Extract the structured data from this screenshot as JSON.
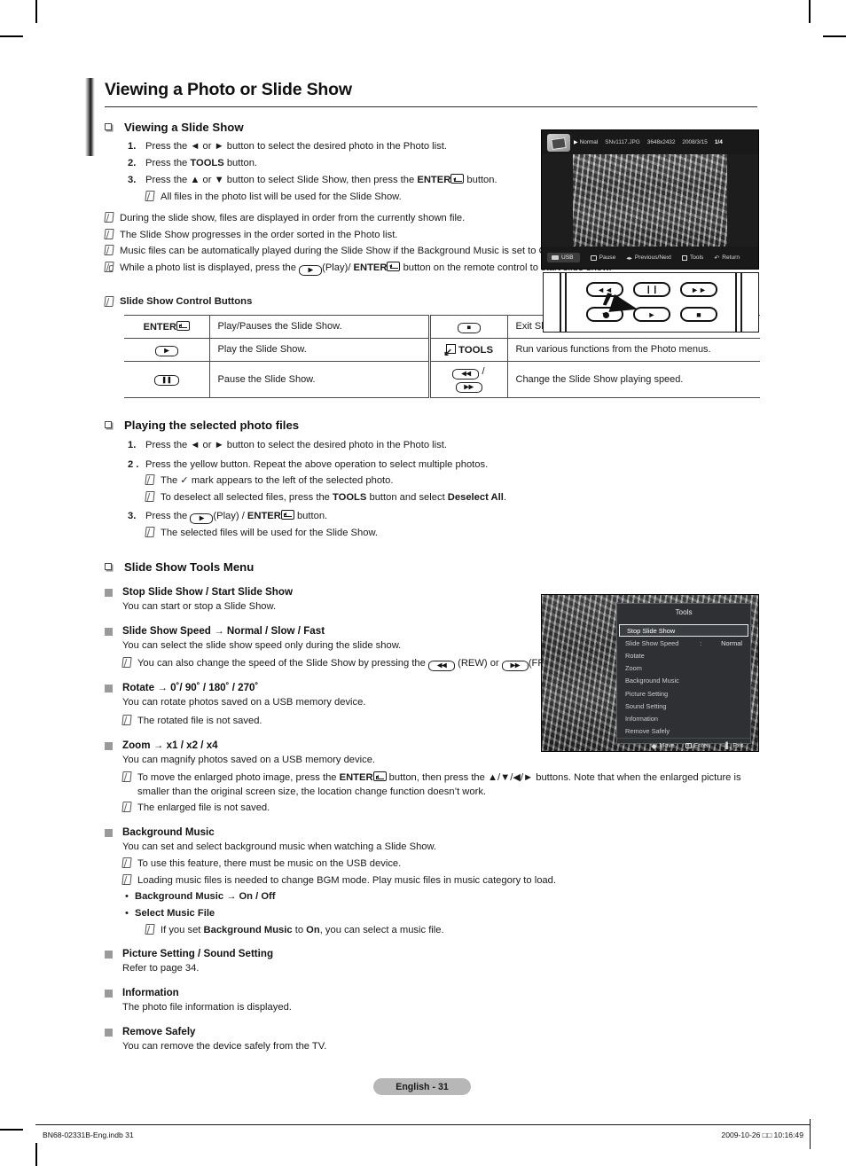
{
  "page": {
    "title": "Viewing a Photo or Slide Show",
    "page_badge": "English - 31",
    "footer_left": "BN68-02331B-Eng.indb  31",
    "footer_right": "2009-10-26  □□ 10:16:49"
  },
  "section_slideshow": {
    "heading": "Viewing a Slide Show",
    "steps": [
      {
        "num": "1.",
        "text": "Press the ◄ or ► button to select the desired photo in the Photo list."
      },
      {
        "num": "2.",
        "text_pre": "Press the ",
        "bold": "TOOLS",
        "text_post": " button."
      },
      {
        "num": "3.",
        "text_pre": "Press the ▲ or ▼ button to select Slide Show, then press the ",
        "bold": "ENTER",
        "text_post": " button."
      }
    ],
    "step3_note": "All files in the photo list will be used for the Slide Show.",
    "notes": [
      "During the slide show, files are displayed in order from the currently shown file.",
      "The Slide Show progresses in the order sorted in the Photo list.",
      "Music files can be automatically played during the Slide Show if the Background Music is set to On."
    ],
    "hand_note_pre": "While a photo list is displayed, press the ",
    "hand_note_mid": "(Play)/ ",
    "hand_note_bold": "ENTER",
    "hand_note_post": " button on the remote control to start slide show."
  },
  "control_table": {
    "title": "Slide Show Control Buttons",
    "rows": [
      {
        "key_left": "ENTER",
        "key_left_type": "enter",
        "desc_left": "Play/Pauses the Slide Show.",
        "key_right": "■",
        "key_right_type": "capsule",
        "desc_right": "Exit Slide Show and return to the photo list."
      },
      {
        "key_left": "►",
        "key_left_type": "capsule",
        "desc_left": "Play the Slide Show.",
        "key_right": "TOOLS",
        "key_right_type": "tools",
        "desc_right": "Run various functions from the Photo menus."
      },
      {
        "key_left": "❙❙",
        "key_left_type": "capsule",
        "desc_left": "Pause the Slide Show.",
        "key_right": "◄◄ / ►►",
        "key_right_type": "capsule-pair",
        "desc_right": "Change the  Slide Show playing speed."
      }
    ]
  },
  "section_selected": {
    "heading": "Playing the selected photo files",
    "step1": {
      "num": "1.",
      "text": "Press the ◄ or ► button to select the desired photo in the Photo list."
    },
    "step2": {
      "num": "2 .",
      "text": "Press the yellow button. Repeat the above operation to select multiple photos."
    },
    "step2_notes": [
      {
        "pre": "The ✓ mark appears to the left of the selected photo.",
        "bold": "",
        "post": ""
      },
      {
        "pre": "To deselect all selected files, press the ",
        "bold": "TOOLS",
        "post": " button and select ",
        "bold2": "Deselect All",
        "post2": "."
      }
    ],
    "step3": {
      "num": "3.",
      "pre": "Press the ",
      "mid": "(Play) / ",
      "bold": "ENTER",
      "post": " button."
    },
    "step3_note": "The selected files will be used for the Slide Show."
  },
  "tools_menu_section": {
    "heading": "Slide Show Tools Menu",
    "items": [
      {
        "title": "Stop Slide Show / Start Slide Show",
        "body": "You can start or stop a Slide Show.",
        "notes": []
      },
      {
        "title": "Slide Show Speed → Normal / Slow / Fast",
        "body": "You can select the slide show speed only during the slide show.",
        "notes": [
          "You can also change the speed of the Slide Show by pressing the  (REW) or (FF) button during the Slide Show."
        ]
      },
      {
        "title": "Rotate → 0˚/ 90˚ / 180˚ / 270˚",
        "body": "You can rotate photos saved on a USB memory device.",
        "notes": [
          "The rotated file is not saved."
        ]
      },
      {
        "title": "Zoom → x1 / x2 / x4",
        "body": "You can magnify photos saved on a USB memory device.",
        "notes": [
          "To move the enlarged photo image, press the ENTER button, then press the ▲/▼/◄/► buttons. Note that when the enlarged picture is smaller than the original screen size, the location change function doesn't work.",
          "The enlarged file is not saved."
        ]
      },
      {
        "title": "Background Music",
        "body": "You can set and select background music when watching a Slide Show.",
        "notes": [
          "To use this feature, there must be music on the USB device.",
          "Loading music files is needed to change BGM mode. Play music files in music category to load."
        ],
        "sub_bullets": [
          "Background Music → On / Off",
          "Select Music File"
        ],
        "sub_note_pre": "If you set ",
        "sub_note_bold": "Background Music",
        "sub_note_mid": " to ",
        "sub_note_bold2": "On",
        "sub_note_post": ", you can select a music file."
      },
      {
        "title": "Picture Setting / Sound Setting",
        "body": "Refer to page 34.",
        "notes": []
      },
      {
        "title": "Information",
        "body": "The photo file information is displayed.",
        "notes": []
      },
      {
        "title": "Remove Safely",
        "body": "You can remove the device safely from the TV.",
        "notes": []
      }
    ]
  },
  "screenshot_slideshow": {
    "mode": "Normal",
    "filename": "SNv1117.JPG",
    "resolution": "3648x2432",
    "date": "2008/3/15",
    "page_index": "1/4",
    "source_label": "USB",
    "hint_pause": "Pause",
    "hint_prevnext": "Previous/Next",
    "hint_tools": "Tools",
    "hint_return": "Return"
  },
  "remote_figure": {
    "buttons": [
      "◄◄",
      "❙❙",
      "►►",
      "▼",
      "►",
      "■"
    ]
  },
  "screenshot_tools": {
    "title": "Tools",
    "items": [
      {
        "label": "Stop Slide Show",
        "value": "",
        "selected": true
      },
      {
        "label": "Slide Show Speed",
        "value": "Normal",
        "selected": false
      },
      {
        "label": "Rotate",
        "value": "",
        "selected": false
      },
      {
        "label": "Zoom",
        "value": "",
        "selected": false
      },
      {
        "label": "Background Music",
        "value": "",
        "selected": false
      },
      {
        "label": "Picture Setting",
        "value": "",
        "selected": false
      },
      {
        "label": "Sound Setting",
        "value": "",
        "selected": false
      },
      {
        "label": "Information",
        "value": "",
        "selected": false
      },
      {
        "label": "Remove Safely",
        "value": "",
        "selected": false
      }
    ],
    "footer": {
      "move": "Move",
      "enter": "Enter",
      "exit": "Exit"
    }
  }
}
